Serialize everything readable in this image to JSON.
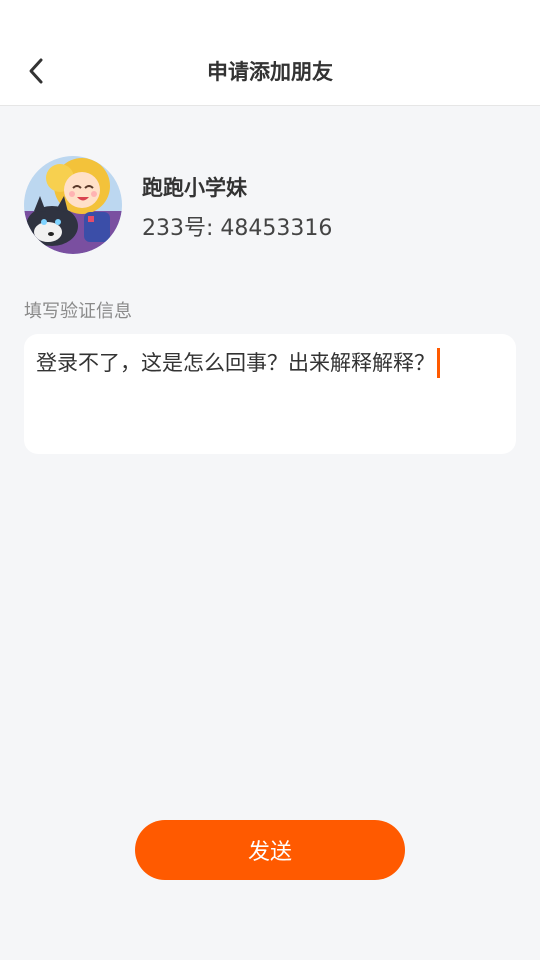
{
  "header": {
    "title": "申请添加朋友",
    "back_icon": "chevron-left-icon"
  },
  "profile": {
    "name": "跑跑小学妹",
    "id_text": "233号: 48453316"
  },
  "verification": {
    "label": "填写验证信息",
    "value": "登录不了，这是怎么回事？出来解释解释？"
  },
  "actions": {
    "send_label": "发送"
  },
  "colors": {
    "accent": "#ff5a00",
    "background": "#f5f6f8"
  }
}
